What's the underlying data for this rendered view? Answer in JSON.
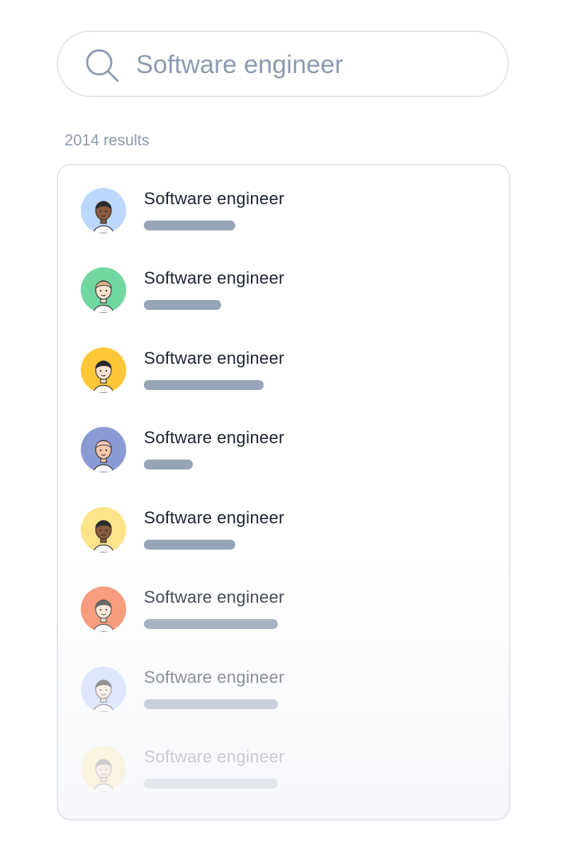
{
  "search": {
    "placeholder": "Software engineer",
    "value": "",
    "icon": "search-icon"
  },
  "results": {
    "count_label": "2014 results",
    "items": [
      {
        "title": "Software engineer",
        "avatar_color": "#bcd8ff",
        "avatar_icon": "man-with-glasses-avatar-icon",
        "skin": "#8a5a3c",
        "hair": "#2a2a2a"
      },
      {
        "title": "Software engineer",
        "avatar_color": "#72d6a0",
        "avatar_icon": "man-with-cap-avatar-icon",
        "skin": "#fbe3d0",
        "hair": "#d8b48a"
      },
      {
        "title": "Software engineer",
        "avatar_color": "#ffc63a",
        "avatar_icon": "woman-short-hair-avatar-icon",
        "skin": "#fbe3d0",
        "hair": "#2a2a2a"
      },
      {
        "title": "Software engineer",
        "avatar_color": "#8a9ad4",
        "avatar_icon": "bald-man-avatar-icon",
        "skin": "#f6c8b0",
        "hair": "#f6c8b0"
      },
      {
        "title": "Software engineer",
        "avatar_color": "#fde48a",
        "avatar_icon": "woman-curly-hair-avatar-icon",
        "skin": "#8a5a3c",
        "hair": "#2a2a2a"
      },
      {
        "title": "Software engineer",
        "avatar_color": "#f58a62",
        "avatar_icon": "bearded-man-avatar-icon",
        "skin": "#fbe3d0",
        "hair": "#4a4a4a"
      },
      {
        "title": "Software engineer",
        "avatar_color": "#c2d4ff",
        "avatar_icon": "woman-long-hair-avatar-icon",
        "skin": "#fbe3d0",
        "hair": "#2a2a2a"
      },
      {
        "title": "Software engineer",
        "avatar_color": "#fde48a",
        "avatar_icon": "woman-avatar-icon",
        "skin": "#f6c8b0",
        "hair": "#2a2a2a"
      }
    ]
  }
}
